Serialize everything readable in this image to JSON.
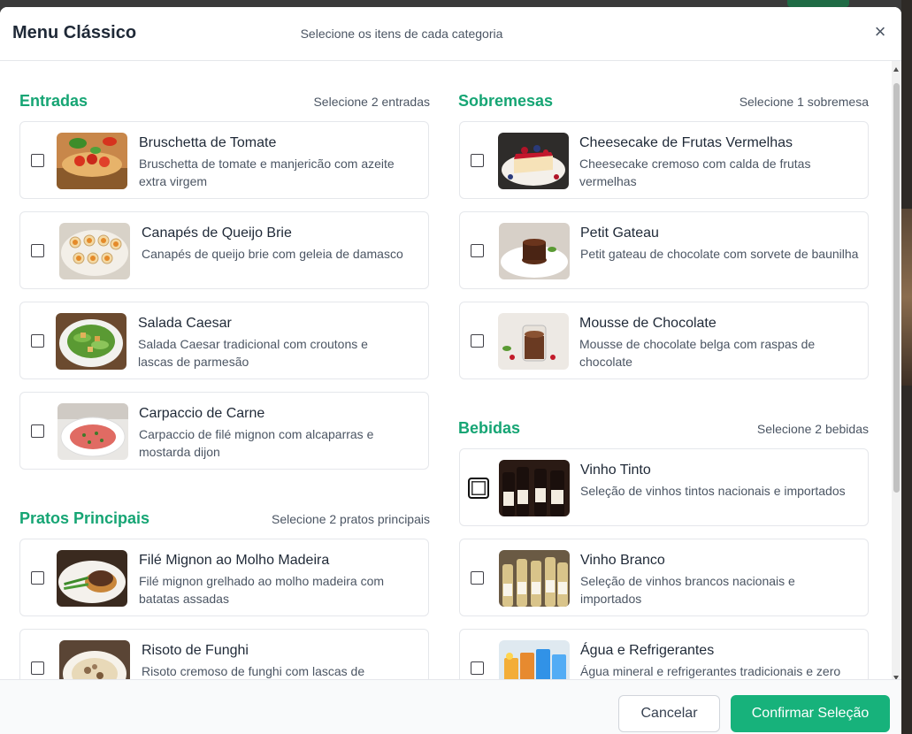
{
  "modal": {
    "title": "Menu Clássico",
    "subtitle": "Selecione os itens de cada categoria",
    "close_label": "×"
  },
  "sections": {
    "entradas": {
      "title": "Entradas",
      "hint": "Selecione 2 entradas",
      "items": [
        {
          "name": "Bruschetta de Tomate",
          "description": "Bruschetta de tomate e manjericão com azeite extra virgem",
          "image": "bruschetta-image"
        },
        {
          "name": "Canapés de Queijo Brie",
          "description": "Canapés de queijo brie com geleia de damasco",
          "image": "canapes-image"
        },
        {
          "name": "Salada Caesar",
          "description": "Salada Caesar tradicional com croutons e lascas de parmesão",
          "image": "salad-image"
        },
        {
          "name": "Carpaccio de Carne",
          "description": "Carpaccio de filé mignon com alcaparras e mostarda dijon",
          "image": "carpaccio-image"
        }
      ]
    },
    "principais": {
      "title": "Pratos Principais",
      "hint": "Selecione 2 pratos principais",
      "items": [
        {
          "name": "Filé Mignon ao Molho Madeira",
          "description": "Filé mignon grelhado ao molho madeira com batatas assadas",
          "image": "steak-image"
        },
        {
          "name": "Risoto de Funghi",
          "description": "Risoto cremoso de funghi com lascas de",
          "image": "risotto-image"
        }
      ]
    },
    "sobremesas": {
      "title": "Sobremesas",
      "hint": "Selecione 1 sobremesa",
      "items": [
        {
          "name": "Cheesecake de Frutas Vermelhas",
          "description": "Cheesecake cremoso com calda de frutas vermelhas",
          "image": "cheesecake-image"
        },
        {
          "name": "Petit Gateau",
          "description": "Petit gateau de chocolate com sorvete de baunilha",
          "image": "petit-gateau-image"
        },
        {
          "name": "Mousse de Chocolate",
          "description": "Mousse de chocolate belga com raspas de chocolate",
          "image": "mousse-image"
        }
      ]
    },
    "bebidas": {
      "title": "Bebidas",
      "hint": "Selecione 2 bebidas",
      "items": [
        {
          "name": "Vinho Tinto",
          "description": "Seleção de vinhos tintos nacionais e importados",
          "image": "red-wine-image"
        },
        {
          "name": "Vinho Branco",
          "description": "Seleção de vinhos brancos nacionais e importados",
          "image": "white-wine-image"
        },
        {
          "name": "Água e Refrigerantes",
          "description": "Água mineral e refrigerantes tradicionais e zero",
          "image": "drinks-image"
        }
      ]
    }
  },
  "footer": {
    "cancel_label": "Cancelar",
    "confirm_label": "Confirmar Seleção"
  },
  "colors": {
    "accent": "#17b27b",
    "section_title": "#16a574"
  }
}
